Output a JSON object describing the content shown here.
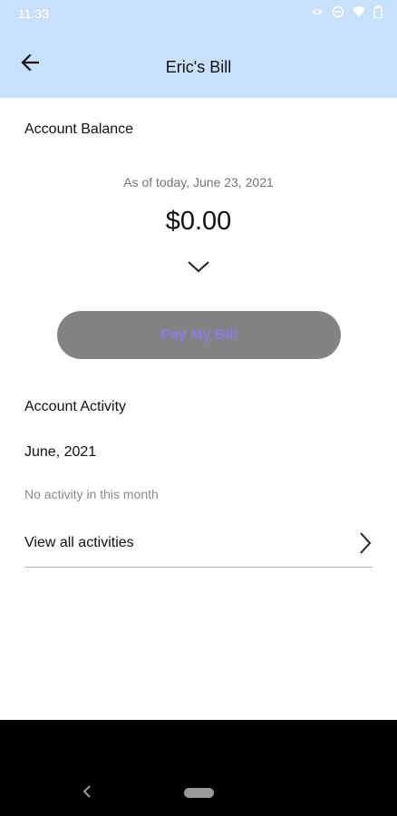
{
  "status_bar": {
    "time": "11:33",
    "icons": [
      "eye-icon",
      "do-not-disturb-icon",
      "wifi-icon",
      "battery-icon"
    ]
  },
  "app_bar": {
    "title": "Eric's Bill",
    "back_icon": "arrow-left-icon",
    "background": "#c7e0fb"
  },
  "balance": {
    "heading": "Account Balance",
    "as_of": "As of today, June 23, 2021",
    "amount": "$0.00",
    "expand_icon": "chevron-down-icon"
  },
  "pay_button": {
    "label": "Pay My Bill",
    "background": "#838383",
    "text_color": "#8f7ae0"
  },
  "activity": {
    "heading": "Account Activity",
    "month": "June, 2021",
    "empty_message": "No activity in this month",
    "view_all_label": "View all activities",
    "view_all_icon": "chevron-right-icon"
  },
  "system_nav": {
    "back_icon": "nav-back-icon",
    "home_icon": "home-pill-icon"
  }
}
